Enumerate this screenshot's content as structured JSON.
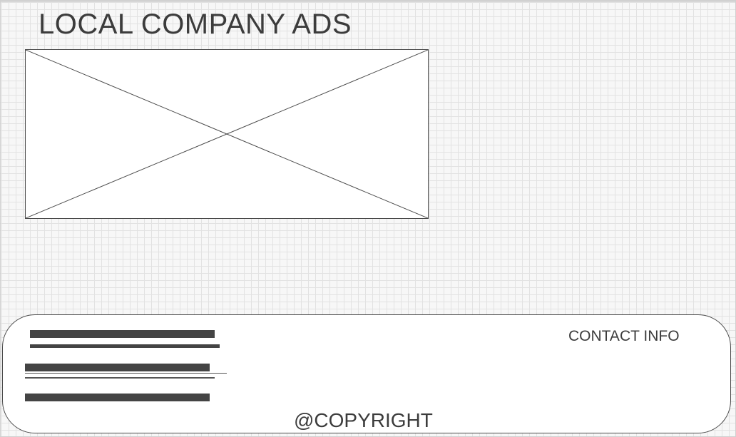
{
  "header": {
    "title": "LOCAL COMPANY ADS"
  },
  "ad_placeholder": {
    "kind": "image-placeholder-x"
  },
  "footer": {
    "contact_label": "CONTACT INFO",
    "copyright_label": "@COPYRIGHT"
  },
  "colors": {
    "background": "#f7f7f7",
    "grid": "#e2e2e2",
    "stroke": "#4a4a4a",
    "text": "#3c3c3c",
    "placeholder_bar": "#444444"
  }
}
